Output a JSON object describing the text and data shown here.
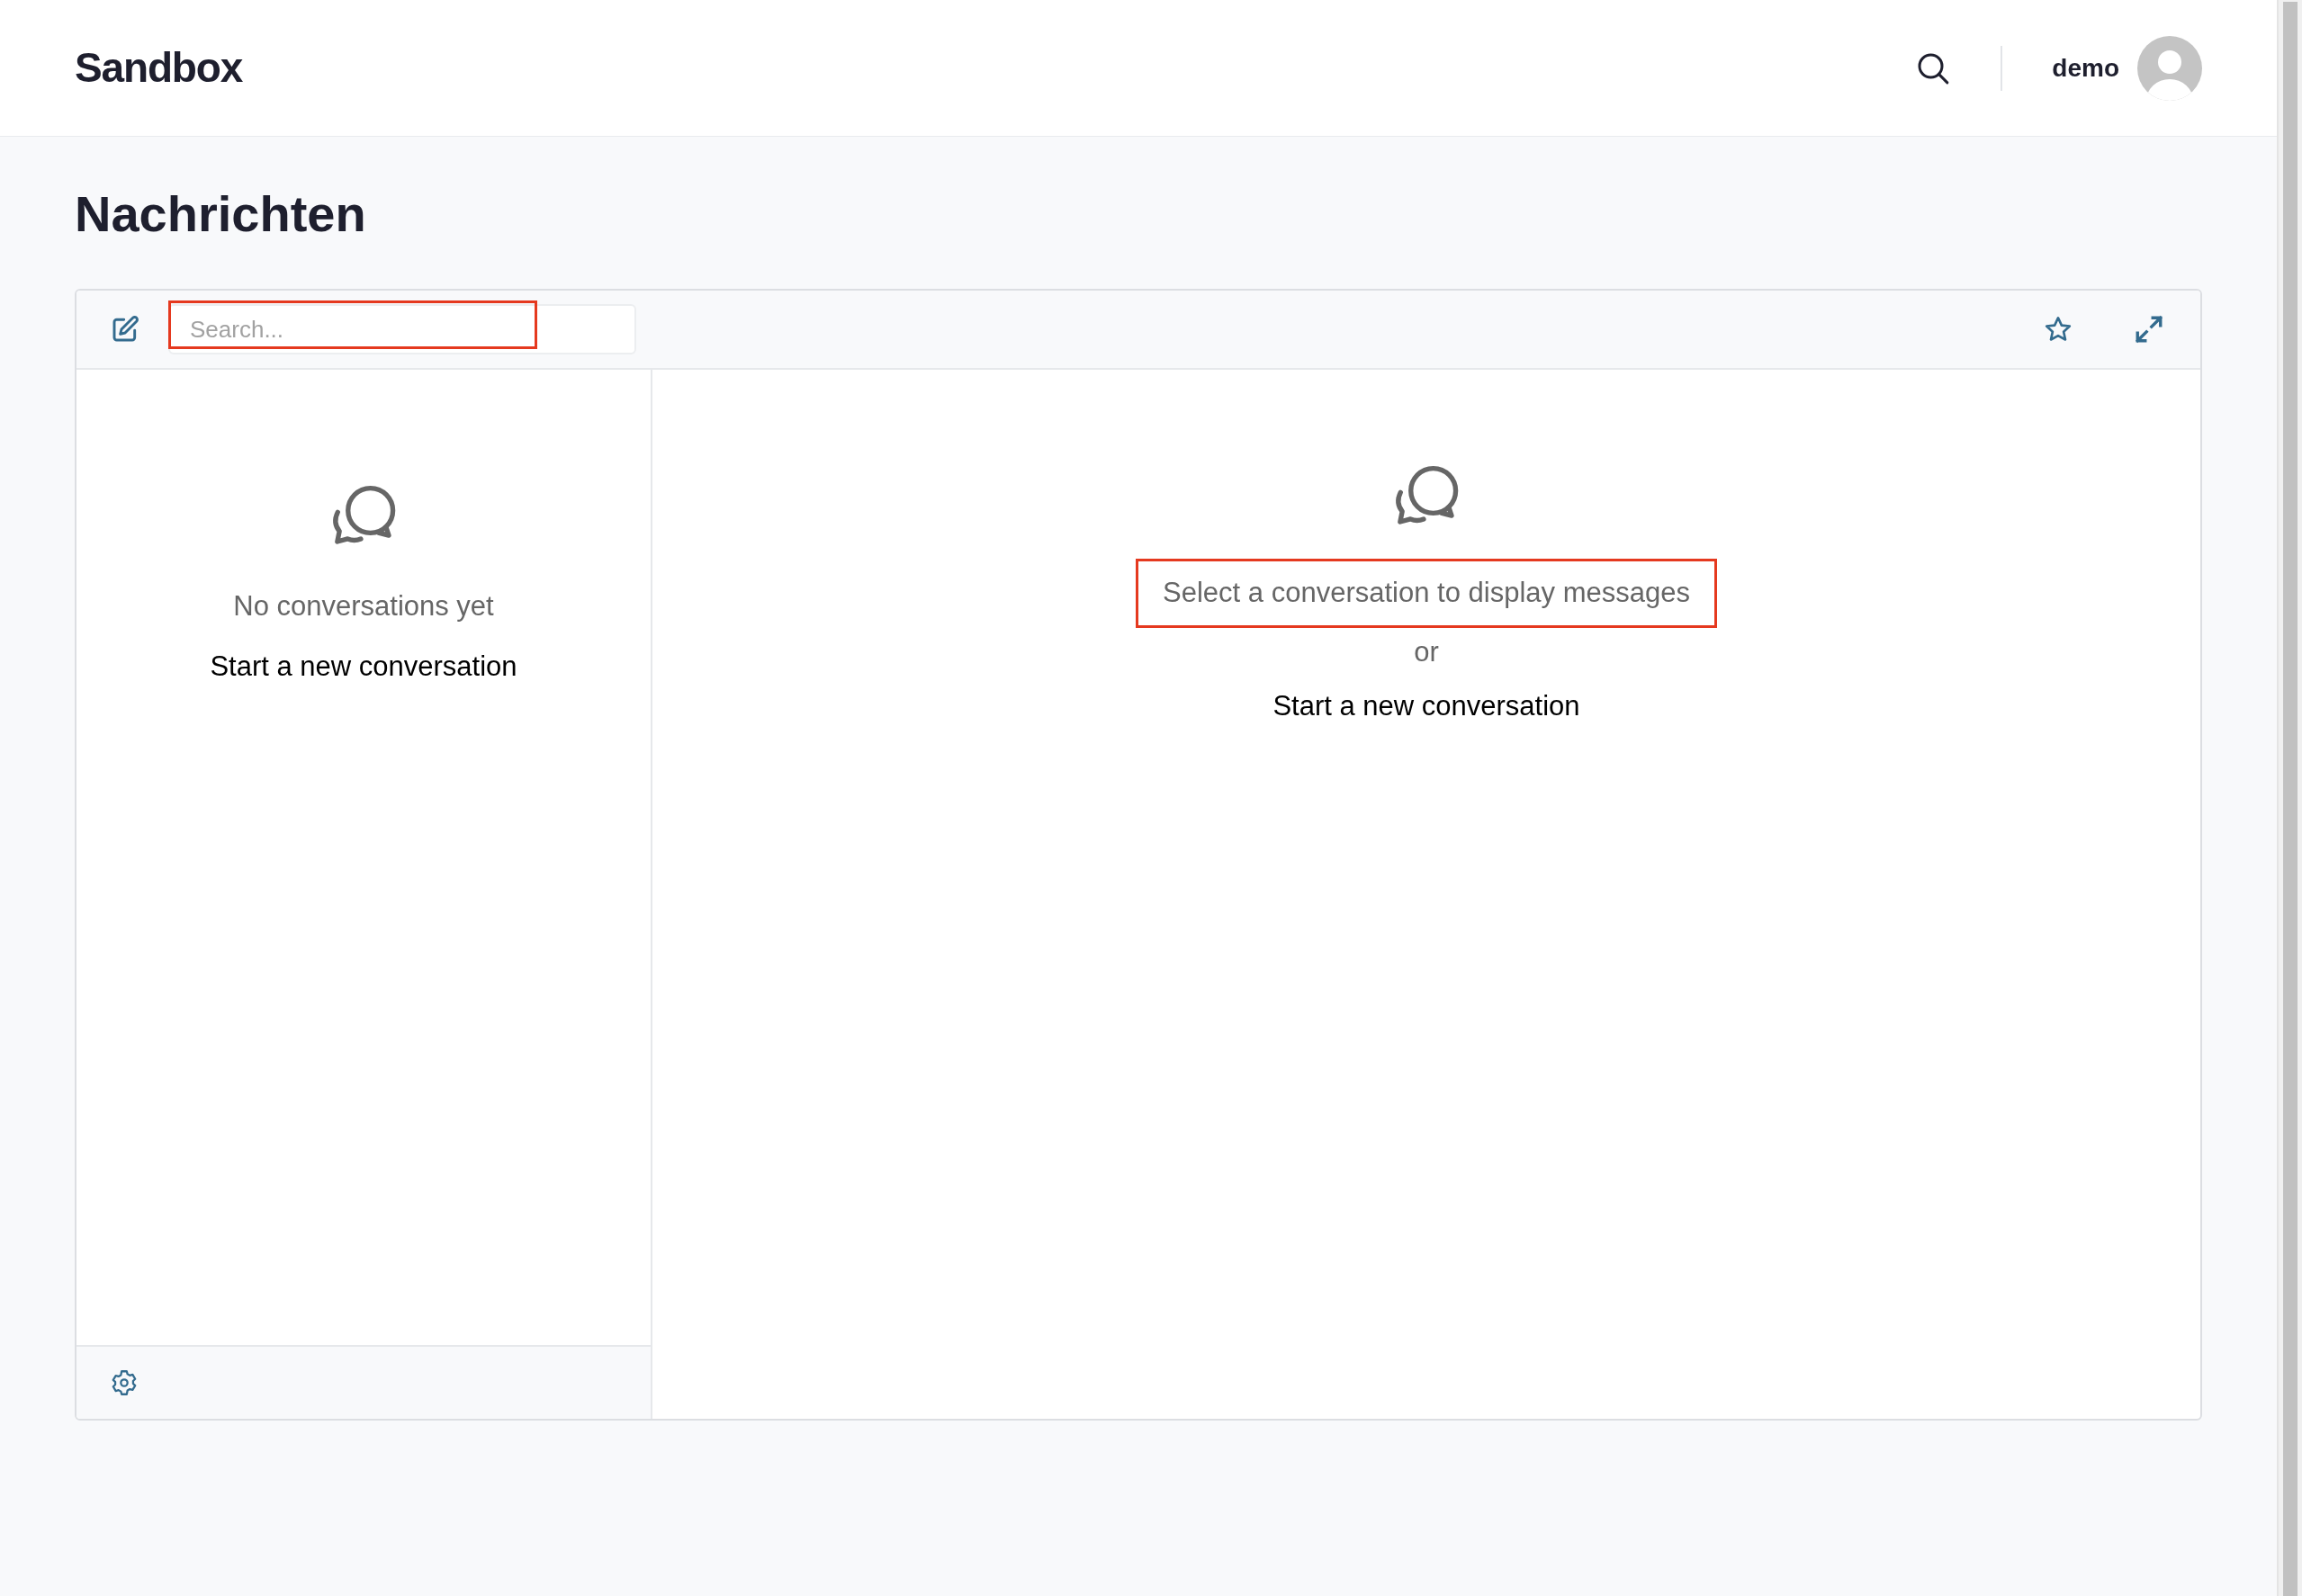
{
  "header": {
    "logo": "Sandbox",
    "username": "demo"
  },
  "page": {
    "title": "Nachrichten"
  },
  "messenger": {
    "search": {
      "placeholder": "Search...",
      "highlighted": true
    },
    "sidebar": {
      "empty_text": "No conversations yet",
      "link": "Start a new conversation"
    },
    "main": {
      "message": "Select a conversation to display messages",
      "message_highlighted": true,
      "or_text": "or",
      "link": "Start a new conversation"
    }
  }
}
